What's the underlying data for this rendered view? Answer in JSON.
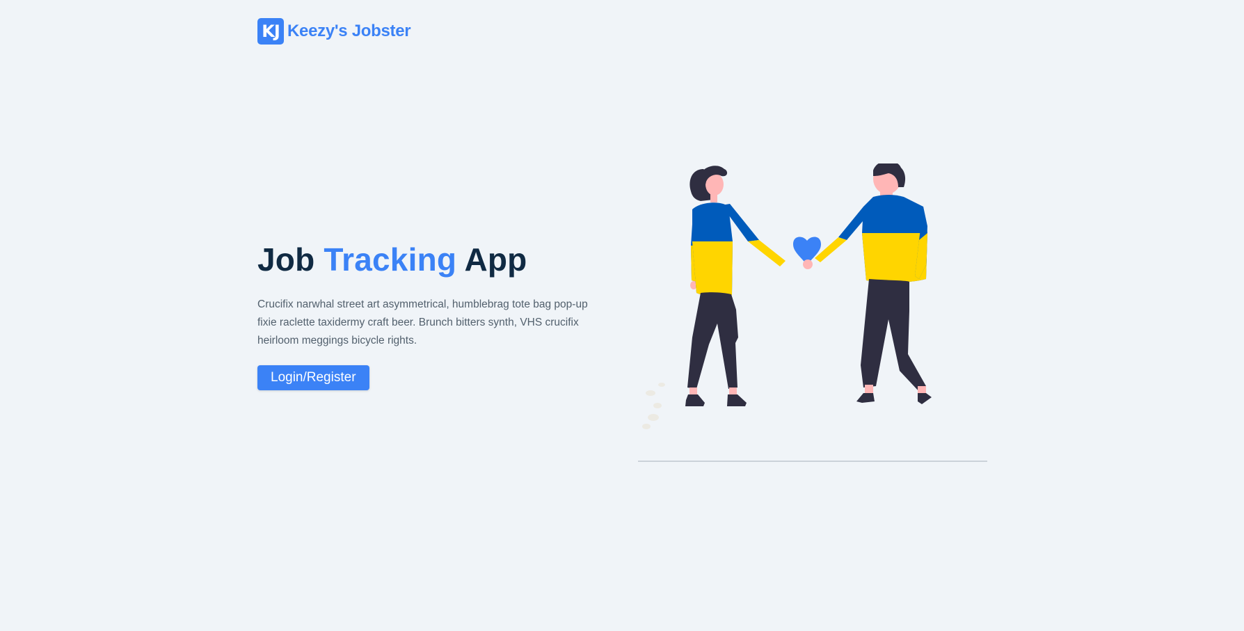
{
  "brand": {
    "logo_letters": "KJ",
    "name": "Keezy's Jobster"
  },
  "hero": {
    "title_part1": "Job ",
    "title_accent": "Tracking",
    "title_part2": " App",
    "description": "Crucifix narwhal street art asymmetrical, humblebrag tote bag pop-up fixie raclette taxidermy craft beer. Brunch bitters synth, VHS crucifix heirloom meggings bicycle rights.",
    "cta_label": "Login/Register"
  },
  "illustration": {
    "subject": "couple-holding-hands-illustration",
    "colors": {
      "accent": "#3b82f6",
      "sweater_blue": "#005bbb",
      "sweater_yellow": "#ffd500",
      "pants": "#2f2e41",
      "skin": "#ffb6b6"
    }
  },
  "colors": {
    "background": "#f0f4f8",
    "primary": "#3b82f6",
    "heading": "#102a43",
    "body_text": "#52606d"
  }
}
